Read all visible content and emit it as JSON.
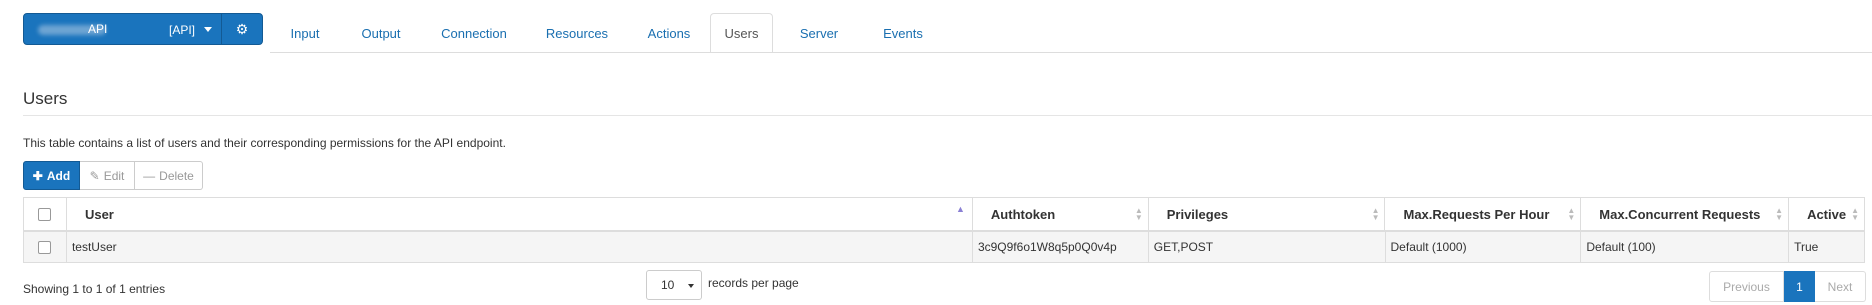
{
  "api_selector": {
    "name_part1": "API",
    "name_part2": "[API]",
    "gear_icon": "gear-icon",
    "caret_icon": "caret-down-icon"
  },
  "tabs": [
    {
      "label": "Input",
      "active": false
    },
    {
      "label": "Output",
      "active": false
    },
    {
      "label": "Connection",
      "active": false
    },
    {
      "label": "Resources",
      "active": false
    },
    {
      "label": "Actions",
      "active": false
    },
    {
      "label": "Users",
      "active": true
    },
    {
      "label": "Server",
      "active": false
    },
    {
      "label": "Events",
      "active": false
    }
  ],
  "section": {
    "title": "Users",
    "description": "This table contains a list of users and their corresponding permissions for the API endpoint."
  },
  "toolbar": {
    "add_label": "Add",
    "edit_label": "Edit",
    "delete_label": "Delete"
  },
  "table": {
    "columns": [
      "User",
      "Authtoken",
      "Privileges",
      "Max.Requests Per Hour",
      "Max.Concurrent Requests",
      "Active"
    ],
    "rows": [
      {
        "user": "testUser",
        "authtoken": "3c9Q9f6o1W8q5p0Q0v4p",
        "privileges": "GET,POST",
        "max_requests": "Default (1000)",
        "max_concurrent": "Default (100)",
        "active": "True"
      }
    ]
  },
  "footer": {
    "info": "Showing 1 to 1 of 1 entries",
    "page_size": "10",
    "records_label": "records per page",
    "prev_label": "Previous",
    "current_page": "1",
    "next_label": "Next"
  },
  "colors": {
    "accent": "#1a74bd",
    "link": "#1a6fb0"
  }
}
